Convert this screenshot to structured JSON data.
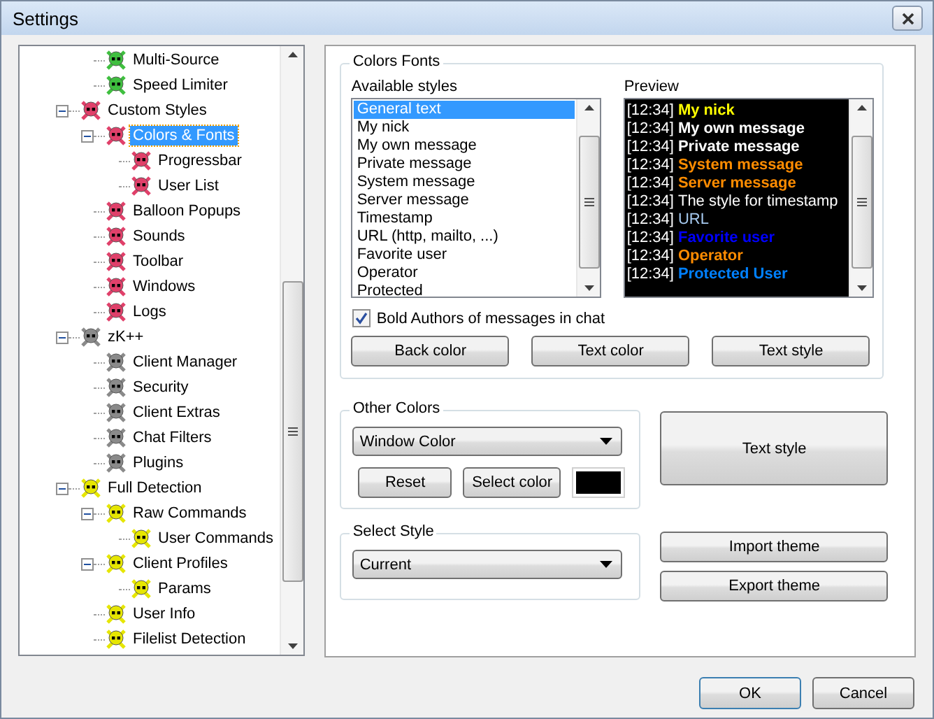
{
  "window": {
    "title": "Settings"
  },
  "tree": {
    "items": [
      {
        "children": [
          {
            "label": "Multi-Source",
            "color": "#3fbf3f",
            "selected": false
          },
          {
            "label": "Speed Limiter",
            "color": "#3fbf3f",
            "selected": false
          }
        ]
      },
      {
        "label": "Custom Styles",
        "color": "#e0406a",
        "selected": false,
        "expanded": true,
        "children": [
          {
            "label": "Colors & Fonts",
            "color": "#e0406a",
            "selected": true,
            "expanded": true,
            "children": [
              {
                "label": "Progressbar",
                "color": "#e0406a",
                "selected": false
              },
              {
                "label": "User List",
                "color": "#e0406a",
                "selected": false
              }
            ]
          },
          {
            "label": "Balloon Popups",
            "color": "#e0406a",
            "selected": false
          },
          {
            "label": "Sounds",
            "color": "#e0406a",
            "selected": false
          },
          {
            "label": "Toolbar",
            "color": "#e0406a",
            "selected": false
          },
          {
            "label": "Windows",
            "color": "#e0406a",
            "selected": false
          },
          {
            "label": "Logs",
            "color": "#e0406a",
            "selected": false
          }
        ]
      },
      {
        "label": "zK++",
        "color": "#8a8a8a",
        "selected": false,
        "expanded": true,
        "children": [
          {
            "label": "Client Manager",
            "color": "#8a8a8a",
            "selected": false
          },
          {
            "label": "Security",
            "color": "#8a8a8a",
            "selected": false
          },
          {
            "label": "Client Extras",
            "color": "#8a8a8a",
            "selected": false
          },
          {
            "label": "Chat Filters",
            "color": "#8a8a8a",
            "selected": false
          },
          {
            "label": "Plugins",
            "color": "#8a8a8a",
            "selected": false
          }
        ]
      },
      {
        "label": "Full Detection",
        "color": "#e6e600",
        "selected": false,
        "expanded": true,
        "children": [
          {
            "label": "Raw Commands",
            "color": "#e6e600",
            "selected": false,
            "expanded": true,
            "children": [
              {
                "label": "User Commands",
                "color": "#e6e600",
                "selected": false
              }
            ]
          },
          {
            "label": "Client Profiles",
            "color": "#e6e600",
            "selected": false,
            "expanded": true,
            "children": [
              {
                "label": "Params",
                "color": "#e6e600",
                "selected": false
              }
            ]
          },
          {
            "label": "User Info",
            "color": "#e6e600",
            "selected": false
          },
          {
            "label": "Filelist Detection",
            "color": "#e6e600",
            "selected": false
          }
        ]
      }
    ]
  },
  "colors_fonts": {
    "title": "Colors  Fonts",
    "styles_label": "Available styles",
    "styles": [
      {
        "label": "General text",
        "selected": true
      },
      {
        "label": "My nick",
        "selected": false
      },
      {
        "label": "My own message",
        "selected": false
      },
      {
        "label": "Private message",
        "selected": false
      },
      {
        "label": "System message",
        "selected": false
      },
      {
        "label": "Server message",
        "selected": false
      },
      {
        "label": "Timestamp",
        "selected": false
      },
      {
        "label": "URL (http, mailto, ...)",
        "selected": false
      },
      {
        "label": "Favorite user",
        "selected": false
      },
      {
        "label": "Operator",
        "selected": false
      },
      {
        "label": "Protected",
        "selected": false
      }
    ],
    "preview_label": "Preview",
    "preview": [
      {
        "time": "[12:34]",
        "text": "My nick",
        "color": "#ffff00",
        "bold": true
      },
      {
        "time": "[12:34]",
        "text": "My own message",
        "color": "#ffffff",
        "bold": true
      },
      {
        "time": "[12:34]",
        "text": "Private message",
        "color": "#ffffff",
        "bold": true
      },
      {
        "time": "[12:34]",
        "text": "System message",
        "color": "#ff8c00",
        "bold": true
      },
      {
        "time": "[12:34]",
        "text": "Server message",
        "color": "#ff8c00",
        "bold": true
      },
      {
        "time": "[12:34]",
        "text": "The style for timestamp",
        "color": "#ffffff",
        "bold": false
      },
      {
        "time": "[12:34]",
        "text": "URL",
        "color": "#a6caf0",
        "bold": false
      },
      {
        "time": "[12:34]",
        "text": "Favorite user",
        "color": "#0000ff",
        "bold": true
      },
      {
        "time": "[12:34]",
        "text": "Operator",
        "color": "#ff8c00",
        "bold": true
      },
      {
        "time": "[12:34]",
        "text": "Protected User",
        "color": "#0080ff",
        "bold": true
      }
    ],
    "bold_authors": {
      "label": "Bold Authors of messages in chat",
      "checked": true
    },
    "buttons": [
      "Back color",
      "Text color",
      "Text style"
    ]
  },
  "other_colors": {
    "title": "Other Colors",
    "value": "Window Color",
    "reset": "Reset",
    "select": "Select color"
  },
  "text_style_button": "Text style",
  "select_style": {
    "title": "Select Style",
    "value": "Current"
  },
  "theme_buttons": [
    "Import theme",
    "Export theme"
  ],
  "footer": {
    "ok": "OK",
    "cancel": "Cancel"
  }
}
